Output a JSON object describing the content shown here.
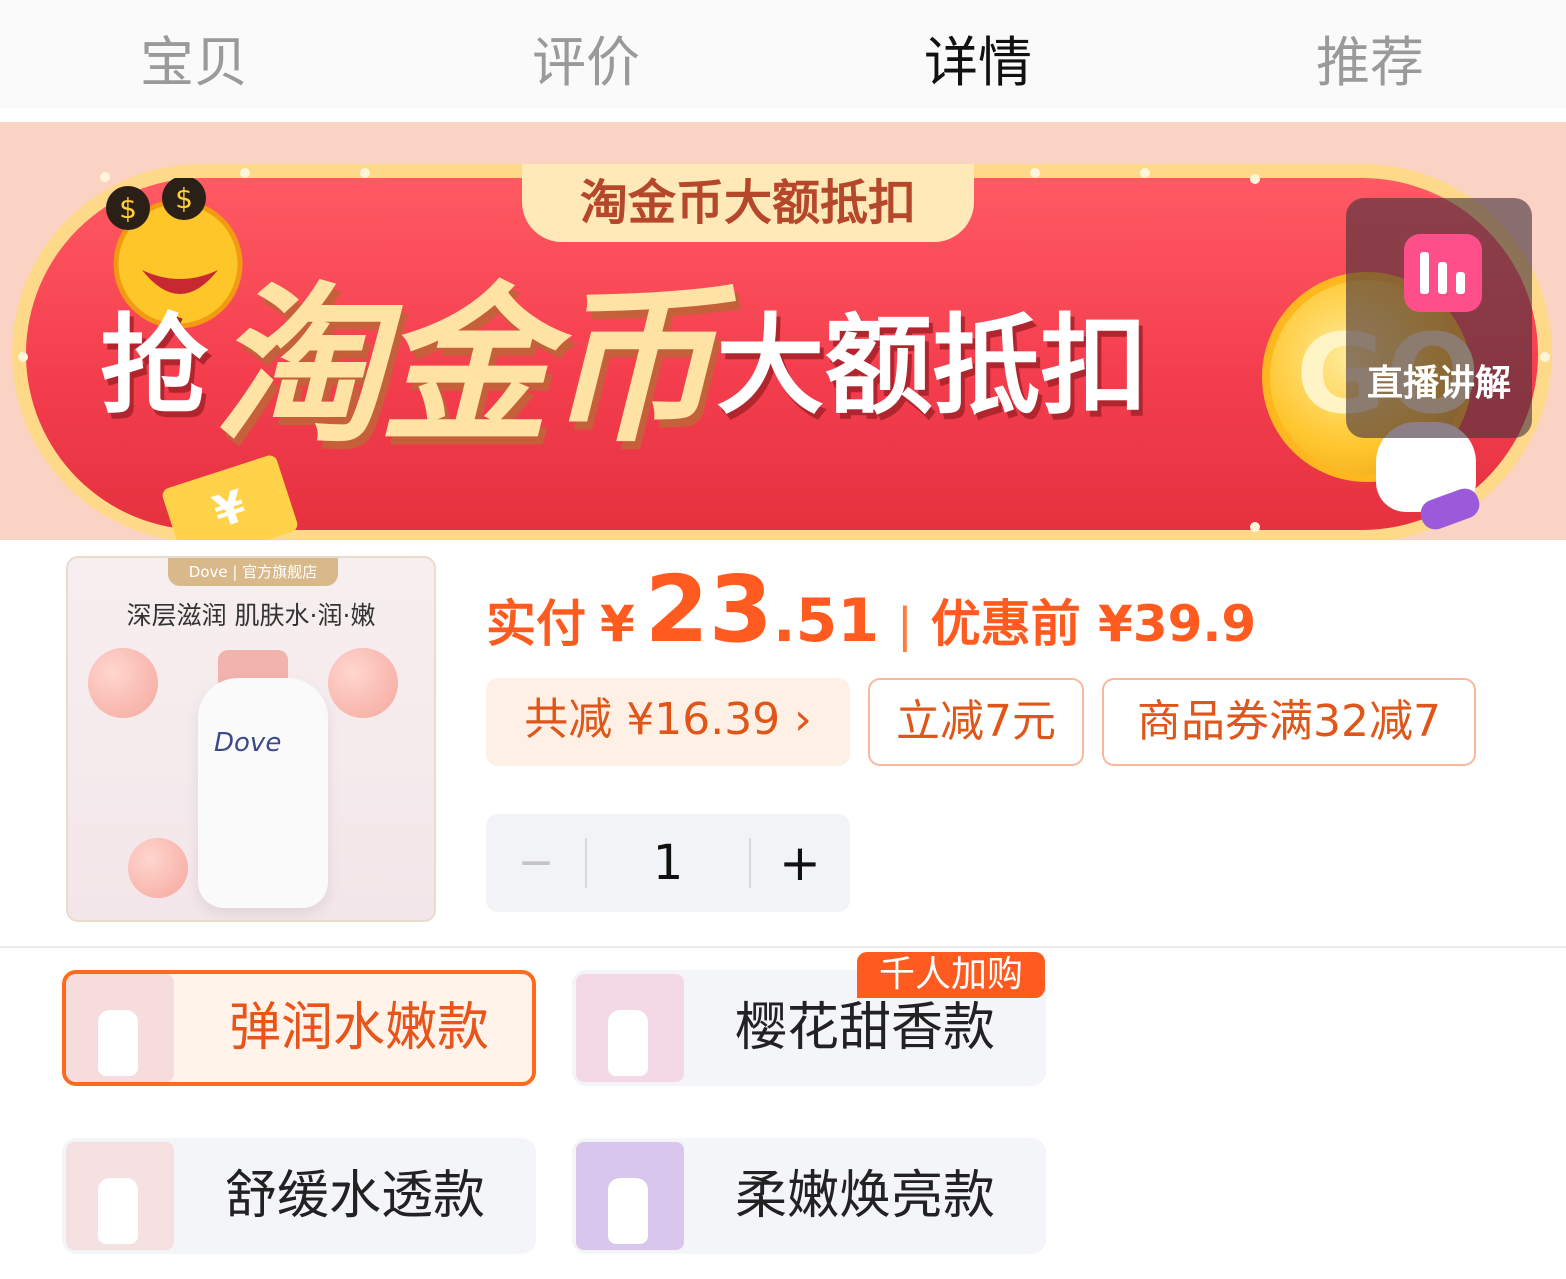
{
  "tabs": [
    {
      "label": "宝贝",
      "active": false
    },
    {
      "label": "评价",
      "active": false
    },
    {
      "label": "详情",
      "active": true
    },
    {
      "label": "推荐",
      "active": false
    }
  ],
  "banner": {
    "top_tag": "淘金币大额抵扣",
    "headline_prefix": "抢",
    "headline_highlight": "淘金币",
    "headline_suffix": "大额抵扣",
    "coin_text": "GO",
    "ticket_symbol": "¥"
  },
  "live": {
    "label": "直播讲解",
    "icon": "live-bars-icon"
  },
  "product": {
    "thumb_brand": "Dove | 官方旗舰店",
    "thumb_tagline": "深层滋润 肌肤水·润·嫩",
    "thumb_bottle_brand": "Dove",
    "price_label": "实付",
    "currency": "¥",
    "price_int": "23",
    "price_dec": ".51",
    "separator": "|",
    "original_label": "优惠前 ¥39.9"
  },
  "discounts": {
    "total": "共减 ¥16.39 ›",
    "instant": "立减7元",
    "coupon": "商品券满32减7"
  },
  "stepper": {
    "minus": "−",
    "value": "1",
    "plus": "+"
  },
  "variants": [
    {
      "label": "弹润水嫩款",
      "selected": true,
      "color": "#f6dcdc"
    },
    {
      "label": "樱花甜香款",
      "selected": false,
      "color": "#f3d9e6",
      "badge": "千人加购"
    },
    {
      "label": "舒缓水透款",
      "selected": false,
      "color": "#f5e1e1"
    },
    {
      "label": "柔嫩焕亮款",
      "selected": false,
      "color": "#d9c6ec"
    }
  ],
  "colors": {
    "accent": "#ff5a1f",
    "banner_red": "#f43e4e",
    "gold_text": "#ffe3a5"
  }
}
